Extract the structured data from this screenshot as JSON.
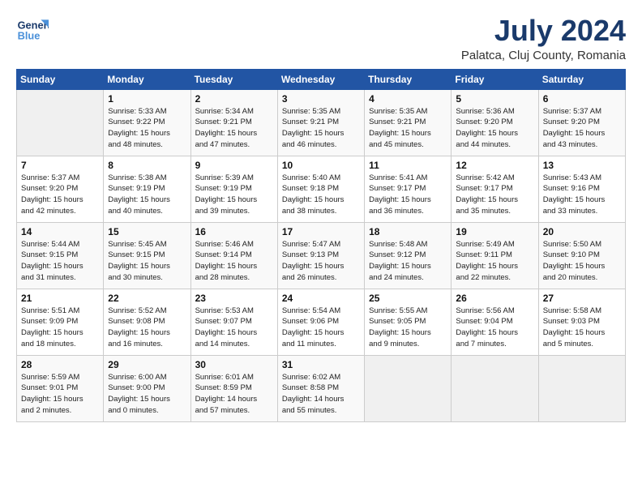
{
  "header": {
    "logo_line1": "General",
    "logo_line2": "Blue",
    "month": "July 2024",
    "location": "Palatca, Cluj County, Romania"
  },
  "weekdays": [
    "Sunday",
    "Monday",
    "Tuesday",
    "Wednesday",
    "Thursday",
    "Friday",
    "Saturday"
  ],
  "weeks": [
    [
      {
        "day": "",
        "info": ""
      },
      {
        "day": "1",
        "info": "Sunrise: 5:33 AM\nSunset: 9:22 PM\nDaylight: 15 hours\nand 48 minutes."
      },
      {
        "day": "2",
        "info": "Sunrise: 5:34 AM\nSunset: 9:21 PM\nDaylight: 15 hours\nand 47 minutes."
      },
      {
        "day": "3",
        "info": "Sunrise: 5:35 AM\nSunset: 9:21 PM\nDaylight: 15 hours\nand 46 minutes."
      },
      {
        "day": "4",
        "info": "Sunrise: 5:35 AM\nSunset: 9:21 PM\nDaylight: 15 hours\nand 45 minutes."
      },
      {
        "day": "5",
        "info": "Sunrise: 5:36 AM\nSunset: 9:20 PM\nDaylight: 15 hours\nand 44 minutes."
      },
      {
        "day": "6",
        "info": "Sunrise: 5:37 AM\nSunset: 9:20 PM\nDaylight: 15 hours\nand 43 minutes."
      }
    ],
    [
      {
        "day": "7",
        "info": "Sunrise: 5:37 AM\nSunset: 9:20 PM\nDaylight: 15 hours\nand 42 minutes."
      },
      {
        "day": "8",
        "info": "Sunrise: 5:38 AM\nSunset: 9:19 PM\nDaylight: 15 hours\nand 40 minutes."
      },
      {
        "day": "9",
        "info": "Sunrise: 5:39 AM\nSunset: 9:19 PM\nDaylight: 15 hours\nand 39 minutes."
      },
      {
        "day": "10",
        "info": "Sunrise: 5:40 AM\nSunset: 9:18 PM\nDaylight: 15 hours\nand 38 minutes."
      },
      {
        "day": "11",
        "info": "Sunrise: 5:41 AM\nSunset: 9:17 PM\nDaylight: 15 hours\nand 36 minutes."
      },
      {
        "day": "12",
        "info": "Sunrise: 5:42 AM\nSunset: 9:17 PM\nDaylight: 15 hours\nand 35 minutes."
      },
      {
        "day": "13",
        "info": "Sunrise: 5:43 AM\nSunset: 9:16 PM\nDaylight: 15 hours\nand 33 minutes."
      }
    ],
    [
      {
        "day": "14",
        "info": "Sunrise: 5:44 AM\nSunset: 9:15 PM\nDaylight: 15 hours\nand 31 minutes."
      },
      {
        "day": "15",
        "info": "Sunrise: 5:45 AM\nSunset: 9:15 PM\nDaylight: 15 hours\nand 30 minutes."
      },
      {
        "day": "16",
        "info": "Sunrise: 5:46 AM\nSunset: 9:14 PM\nDaylight: 15 hours\nand 28 minutes."
      },
      {
        "day": "17",
        "info": "Sunrise: 5:47 AM\nSunset: 9:13 PM\nDaylight: 15 hours\nand 26 minutes."
      },
      {
        "day": "18",
        "info": "Sunrise: 5:48 AM\nSunset: 9:12 PM\nDaylight: 15 hours\nand 24 minutes."
      },
      {
        "day": "19",
        "info": "Sunrise: 5:49 AM\nSunset: 9:11 PM\nDaylight: 15 hours\nand 22 minutes."
      },
      {
        "day": "20",
        "info": "Sunrise: 5:50 AM\nSunset: 9:10 PM\nDaylight: 15 hours\nand 20 minutes."
      }
    ],
    [
      {
        "day": "21",
        "info": "Sunrise: 5:51 AM\nSunset: 9:09 PM\nDaylight: 15 hours\nand 18 minutes."
      },
      {
        "day": "22",
        "info": "Sunrise: 5:52 AM\nSunset: 9:08 PM\nDaylight: 15 hours\nand 16 minutes."
      },
      {
        "day": "23",
        "info": "Sunrise: 5:53 AM\nSunset: 9:07 PM\nDaylight: 15 hours\nand 14 minutes."
      },
      {
        "day": "24",
        "info": "Sunrise: 5:54 AM\nSunset: 9:06 PM\nDaylight: 15 hours\nand 11 minutes."
      },
      {
        "day": "25",
        "info": "Sunrise: 5:55 AM\nSunset: 9:05 PM\nDaylight: 15 hours\nand 9 minutes."
      },
      {
        "day": "26",
        "info": "Sunrise: 5:56 AM\nSunset: 9:04 PM\nDaylight: 15 hours\nand 7 minutes."
      },
      {
        "day": "27",
        "info": "Sunrise: 5:58 AM\nSunset: 9:03 PM\nDaylight: 15 hours\nand 5 minutes."
      }
    ],
    [
      {
        "day": "28",
        "info": "Sunrise: 5:59 AM\nSunset: 9:01 PM\nDaylight: 15 hours\nand 2 minutes."
      },
      {
        "day": "29",
        "info": "Sunrise: 6:00 AM\nSunset: 9:00 PM\nDaylight: 15 hours\nand 0 minutes."
      },
      {
        "day": "30",
        "info": "Sunrise: 6:01 AM\nSunset: 8:59 PM\nDaylight: 14 hours\nand 57 minutes."
      },
      {
        "day": "31",
        "info": "Sunrise: 6:02 AM\nSunset: 8:58 PM\nDaylight: 14 hours\nand 55 minutes."
      },
      {
        "day": "",
        "info": ""
      },
      {
        "day": "",
        "info": ""
      },
      {
        "day": "",
        "info": ""
      }
    ]
  ]
}
